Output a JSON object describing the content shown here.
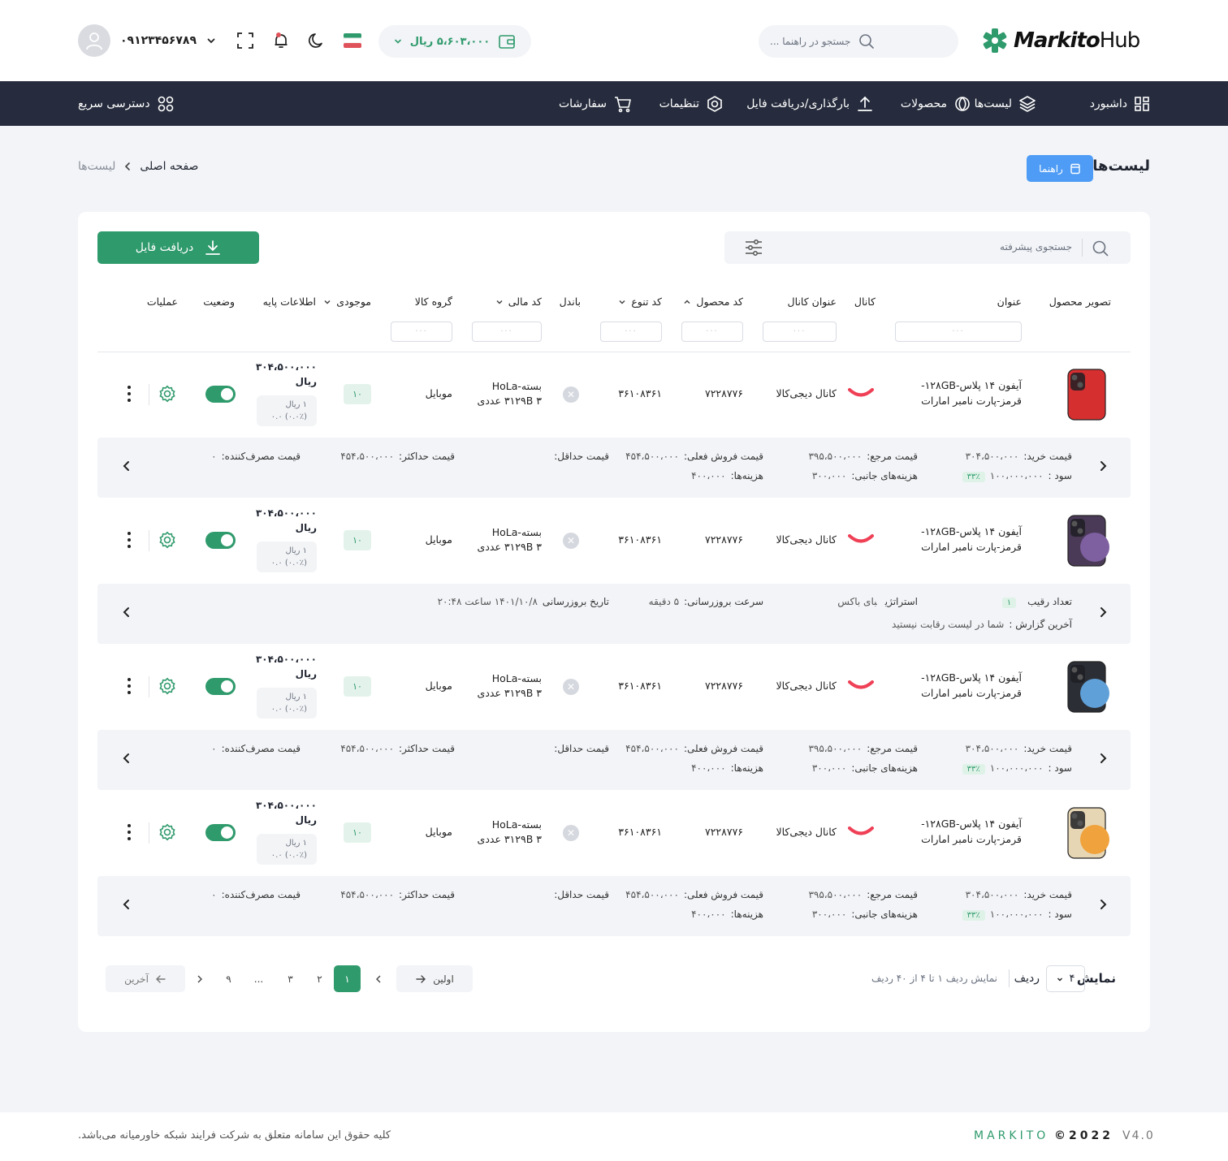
{
  "header": {
    "logo_primary": "Markito",
    "logo_secondary": "Hub",
    "search_placeholder": "جستجو در راهنما ...",
    "wallet_amount": "۵،۶۰۳،۰۰۰ ریال",
    "phone": "۰۹۱۲۳۴۵۶۷۸۹"
  },
  "nav": {
    "items": [
      "داشبورد",
      "لیست‌ها",
      "محصولات",
      "بارگذاری/دریافت فایل",
      "تنظیمات",
      "سفارشات"
    ],
    "quick_access": "دسترسی سریع"
  },
  "page": {
    "title": "لیست‌ها",
    "guide_label": "راهنما",
    "breadcrumb_home": "صفحه اصلی",
    "breadcrumb_current": "لیست‌ها"
  },
  "toolbar": {
    "search_placeholder": "جستجوی پیشرفته",
    "download_label": "دریافت فایل"
  },
  "table": {
    "columns": [
      "تصویر محصول",
      "عنوان",
      "کانال",
      "عنوان کانال",
      "کد محصول",
      "کد تنوع",
      "باندل",
      "کد مالی",
      "گروه کالا",
      "موجودی",
      "اطلاعات پایه",
      "وضعیت",
      "عملیات"
    ],
    "filter_placeholder": "···",
    "rows": [
      {
        "title": "آیفون ۱۴ پلاس-۱۲۸GB-قرمز-پارت نامبر امارات",
        "channel_title": "کانال دیجی‌کالا",
        "product_code": "۷۲۲۸۷۷۶",
        "variant_code": "۳۶۱۰۸۳۶۱",
        "finance_code": "بسته-HoLa ۳۱۲۹B ۳ عددی",
        "group": "موبایل",
        "stock": "۱۰",
        "price": "۳۰۴،۵۰۰،۰۰۰",
        "currency": "ریال",
        "base_line1": "۱ ریال",
        "base_line2": "(۰.۰٪) ۰.۰",
        "status_on": true
      },
      {
        "title": "آیفون ۱۴ پلاس-۱۲۸GB-قرمز-پارت نامبر امارات",
        "channel_title": "کانال دیجی‌کالا",
        "product_code": "۷۲۲۸۷۷۶",
        "variant_code": "۳۶۱۰۸۳۶۱",
        "finance_code": "بسته-HoLa ۳۱۲۹B ۳ عددی",
        "group": "موبایل",
        "stock": "۱۰",
        "price": "۳۰۴،۵۰۰،۰۰۰",
        "currency": "ریال",
        "base_line1": "۱ ریال",
        "base_line2": "(۰.۰٪) ۰.۰",
        "status_on": true
      },
      {
        "title": "آیفون ۱۴ پلاس-۱۲۸GB-قرمز-پارت نامبر امارات",
        "channel_title": "کانال دیجی‌کالا",
        "product_code": "۷۲۲۸۷۷۶",
        "variant_code": "۳۶۱۰۸۳۶۱",
        "finance_code": "بسته-HoLa ۳۱۲۹B ۳ عددی",
        "group": "موبایل",
        "stock": "۱۰",
        "price": "۳۰۴،۵۰۰،۰۰۰",
        "currency": "ریال",
        "base_line1": "۱ ریال",
        "base_line2": "(۰.۰٪) ۰.۰",
        "status_on": true
      },
      {
        "title": "آیفون ۱۴ پلاس-۱۲۸GB-قرمز-پارت نامبر امارات",
        "channel_title": "کانال دیجی‌کالا",
        "product_code": "۷۲۲۸۷۷۶",
        "variant_code": "۳۶۱۰۸۳۶۱",
        "finance_code": "بسته-HoLa ۳۱۲۹B ۳ عددی",
        "group": "موبایل",
        "stock": "۱۰",
        "price": "۳۰۴،۵۰۰،۰۰۰",
        "currency": "ریال",
        "base_line1": "۱ ریال",
        "base_line2": "(۰.۰٪) ۰.۰",
        "status_on": true
      }
    ],
    "price_details": {
      "buy_label": "قیمت خرید:",
      "buy_value": "۳۰۴،۵۰۰،۰۰۰",
      "profit_label": "سود :",
      "profit_value": "۱۰۰،۰۰۰،۰۰۰",
      "profit_pct": "۳۳٪",
      "ref_label": "قیمت مرجع:",
      "ref_value": "۳۹۵،۵۰۰،۰۰۰",
      "side_label": "هزینه‌های جانبی:",
      "side_value": "۳۰۰،۰۰۰",
      "sell_label": "قیمت فروش فعلی:",
      "sell_value": "۴۵۴،۵۰۰،۰۰۰",
      "cost_label": "هزینه‌ها:",
      "cost_value": "۴۰۰،۰۰۰",
      "min_label": "قیمت حداقل:",
      "min_value": "",
      "max_label": "قیمت حداکثر:",
      "max_value": "۴۵۴،۵۰۰،۰۰۰",
      "consumer_label": "قیمت مصرف‌کننده:",
      "consumer_value": "۰"
    },
    "competition_details": {
      "rivals_label": "تعداد رقیب",
      "rivals_value": "۱",
      "strategy_label": "استراتژی",
      "strategy_value": "بای باکس",
      "speed_label": "سرعت بروزرسانی:",
      "speed_value": "۵ دقیقه",
      "date_label": "تاریخ بروزرسانی",
      "date_value": "۱۴۰۱/۱۰/۸ ساعت ۲۰:۴۸",
      "report_label": "آخرین گزارش :",
      "report_value": "شما در لیست رقابت نیستید"
    }
  },
  "pagination": {
    "show_label": "نمایش",
    "page_size": "۴",
    "rows_label": "ردیف",
    "summary": "نمایش ردیف ۱ تا ۴ از ۴۰ ردیف",
    "first_label": "اولین",
    "last_label": "آخرین",
    "pages": [
      "۱",
      "۲",
      "۳",
      "...",
      "۹"
    ]
  },
  "footer": {
    "copyright": "کلیه حقوق این سامانه متعلق به شرکت فرایند شبکه خاورمیانه می‌باشد.",
    "brand": "MARKITO",
    "year": "©2022",
    "version": "V4.0"
  },
  "colors": {
    "accent": "#2f9a6c",
    "nav_bg": "#262c3d",
    "guide_button": "#4e9cf5",
    "page_bg": "#f2f4f8"
  }
}
